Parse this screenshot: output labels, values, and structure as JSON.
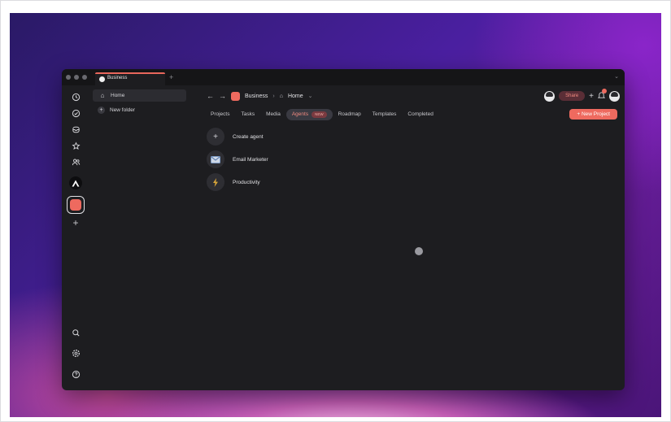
{
  "titlebar": {
    "tab_label": "Business",
    "new_tab": "+",
    "overflow": "⌄"
  },
  "rail": {
    "icons": [
      "clock-icon",
      "check-circle-icon",
      "inbox-icon",
      "star-icon",
      "people-icon"
    ],
    "spaces": [
      {
        "name": "a-space-icon",
        "glyph": "A",
        "color": "#0d0d0f"
      },
      {
        "name": "business-space-icon",
        "color": "#ee6a5f"
      }
    ],
    "add_space": "+",
    "bottom_icons": [
      "search-icon",
      "gear-icon",
      "help-icon"
    ]
  },
  "sidebar": {
    "items": [
      {
        "label": "Home",
        "icon": "⌂",
        "active": true
      },
      {
        "label": "New folder",
        "icon": "+",
        "active": false
      }
    ]
  },
  "breadcrumb": {
    "back": "←",
    "forward": "→",
    "workspace": "Business",
    "separator": "›",
    "page": "Home",
    "page_chevron": "⌄"
  },
  "header": {
    "share_label": "Share",
    "plus": "+"
  },
  "tabs": [
    {
      "label": "Projects",
      "active": false
    },
    {
      "label": "Tasks",
      "active": false
    },
    {
      "label": "Media",
      "active": false
    },
    {
      "label": "Agents",
      "active": true,
      "badge": "NEW"
    },
    {
      "label": "Roadmap",
      "active": false
    },
    {
      "label": "Templates",
      "active": false
    },
    {
      "label": "Completed",
      "active": false
    }
  ],
  "new_project_label": "+ New Project",
  "agents": [
    {
      "label": "Create agent",
      "icon": "+",
      "icon_name": "plus-icon"
    },
    {
      "label": "Email Marketer",
      "icon": "📧",
      "icon_name": "email-icon"
    },
    {
      "label": "Productivity",
      "icon": "⚡",
      "icon_name": "lightning-icon"
    }
  ],
  "colors": {
    "accent": "#ee6a5f",
    "window_bg": "#1d1d20",
    "active_tab_text": "#f08a80"
  }
}
